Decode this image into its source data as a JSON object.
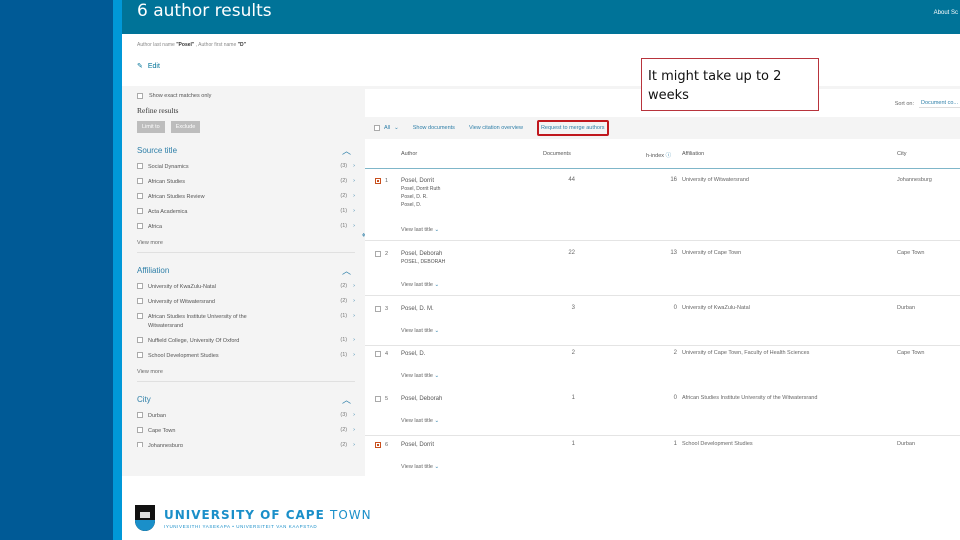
{
  "header": {
    "title": "6 author results",
    "about_link": "About Sc"
  },
  "query": {
    "prefix": "Author last name ",
    "last_name": "\"Posel\"",
    "middle": " , Author first name ",
    "first_name": "\"D\""
  },
  "edit_label": "Edit",
  "sidebar": {
    "exact_matches_label": "Show exact matches only",
    "refine_title": "Refine results",
    "limit_label": "Limit to",
    "exclude_label": "Exclude",
    "facets": [
      {
        "title": "Source title",
        "items": [
          {
            "label": "Social Dynamics",
            "count": "(3)"
          },
          {
            "label": "African Studies",
            "count": "(2)"
          },
          {
            "label": "African Studies Review",
            "count": "(2)"
          },
          {
            "label": "Acta Academica",
            "count": "(1)"
          },
          {
            "label": "Africa",
            "count": "(1)"
          }
        ],
        "view_more": "View more"
      },
      {
        "title": "Affiliation",
        "items": [
          {
            "label": "University of KwaZulu-Natal",
            "count": "(2)"
          },
          {
            "label": "University of Witwatersrand",
            "count": "(2)"
          },
          {
            "label": "African Studies Institute University of the Witwatersrand",
            "count": "(1)"
          },
          {
            "label": "Nuffield College, University Of Oxford",
            "count": "(1)"
          },
          {
            "label": "School Development Studies",
            "count": "(1)"
          }
        ],
        "view_more": "View more"
      },
      {
        "title": "City",
        "items": [
          {
            "label": "Durban",
            "count": "(3)"
          },
          {
            "label": "Cape Town",
            "count": "(2)"
          },
          {
            "label": "Johannesburg",
            "count": "(2)"
          }
        ]
      }
    ]
  },
  "results": {
    "sort_label": "Sort on:",
    "sort_value": "Document co...",
    "toolbar": {
      "all": "All",
      "show_documents": "Show documents",
      "view_citation_overview": "View citation overview",
      "request_merge": "Request to merge authors"
    },
    "columns": {
      "author": "Author",
      "documents": "Documents",
      "h_index": "h-index",
      "affiliation": "Affiliation",
      "city": "City"
    },
    "view_last_title": "View last title",
    "rows": [
      {
        "num": "1",
        "checked": true,
        "author": "Posel, Dorrit",
        "variants": [
          "Posel, Dorrit Ruth",
          "Posel, D. R.",
          "Posel, D."
        ],
        "documents": "44",
        "h_index": "16",
        "affiliation": "University of Witwatersrand",
        "city": "Johannesburg"
      },
      {
        "num": "2",
        "checked": false,
        "author": "Posel, Deborah",
        "variants": [
          "POSEL, DEBORAH"
        ],
        "documents": "22",
        "h_index": "13",
        "affiliation": "University of Cape Town",
        "city": "Cape Town"
      },
      {
        "num": "3",
        "checked": false,
        "author": "Posel, D. M.",
        "variants": [],
        "documents": "3",
        "h_index": "0",
        "affiliation": "University of KwaZulu-Natal",
        "city": "Durban"
      },
      {
        "num": "4",
        "checked": false,
        "author": "Posel, D.",
        "variants": [],
        "documents": "2",
        "h_index": "2",
        "affiliation": "University of Cape Town, Faculty of Health Sciences",
        "city": "Cape Town"
      },
      {
        "num": "5",
        "checked": false,
        "author": "Posel, Deborah",
        "variants": [],
        "documents": "1",
        "h_index": "0",
        "affiliation": "African Studies Institute University of the Witwatersrand",
        "city": ""
      },
      {
        "num": "6",
        "checked": true,
        "author": "Posel, Dorrit",
        "variants": [],
        "documents": "1",
        "h_index": "1",
        "affiliation": "School Development Studies",
        "city": "Durban"
      }
    ]
  },
  "footer": {
    "university_bold": "UNIVERSITY OF CAPE ",
    "university_light": "TOWN",
    "tagline": "IYUNIVESITHI YASEKAPA • UNIVERSITEIT VAN KAAPSTAD"
  },
  "callout": {
    "text": "It might take up to 2 weeks"
  },
  "colors": {
    "header": "#007398",
    "left_band": "#005a96",
    "accent_stripe": "#0098d8",
    "link": "#2e7fa8",
    "highlight_border": "#c0181e",
    "checked": "#c8501e"
  }
}
